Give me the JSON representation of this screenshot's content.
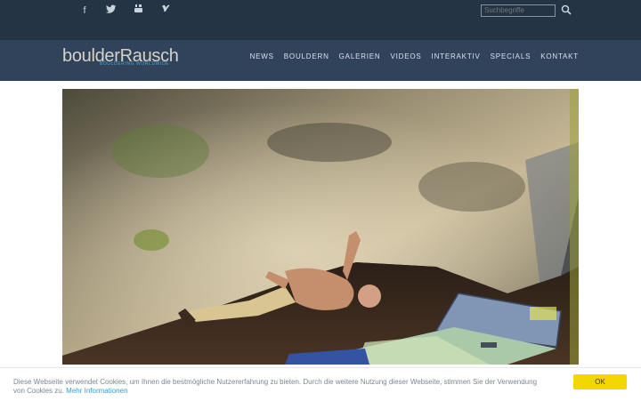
{
  "social": {
    "icons": [
      "facebook-icon",
      "twitter-icon",
      "youtube-icon",
      "vimeo-icon"
    ],
    "glyphs": [
      "f",
      "🐦",
      "▶",
      "V"
    ]
  },
  "search": {
    "placeholder": "Suchbegriffe"
  },
  "logo": {
    "title": "boulderRausch",
    "subtitle": "BOULDERING WORLDWIDE"
  },
  "nav": {
    "items": [
      "NEWS",
      "BOULDERN",
      "GALERIEN",
      "VIDEOS",
      "INTERAKTIV",
      "SPECIALS",
      "KONTAKT"
    ]
  },
  "cookie": {
    "text": "Diese Webseite verwendet Cookies, um Ihnen die bestmögliche Nutzererfahrung zu bieten. Durch die weitere Nutzung dieser Webseite, stimmen Sie der Verwendung von Cookies zu.",
    "link": "Mehr Informationen",
    "button": "OK"
  },
  "colors": {
    "topbar": "#253444",
    "navbar": "#31435a",
    "accent": "#4da7cf",
    "cookie_button": "#f2d600"
  }
}
